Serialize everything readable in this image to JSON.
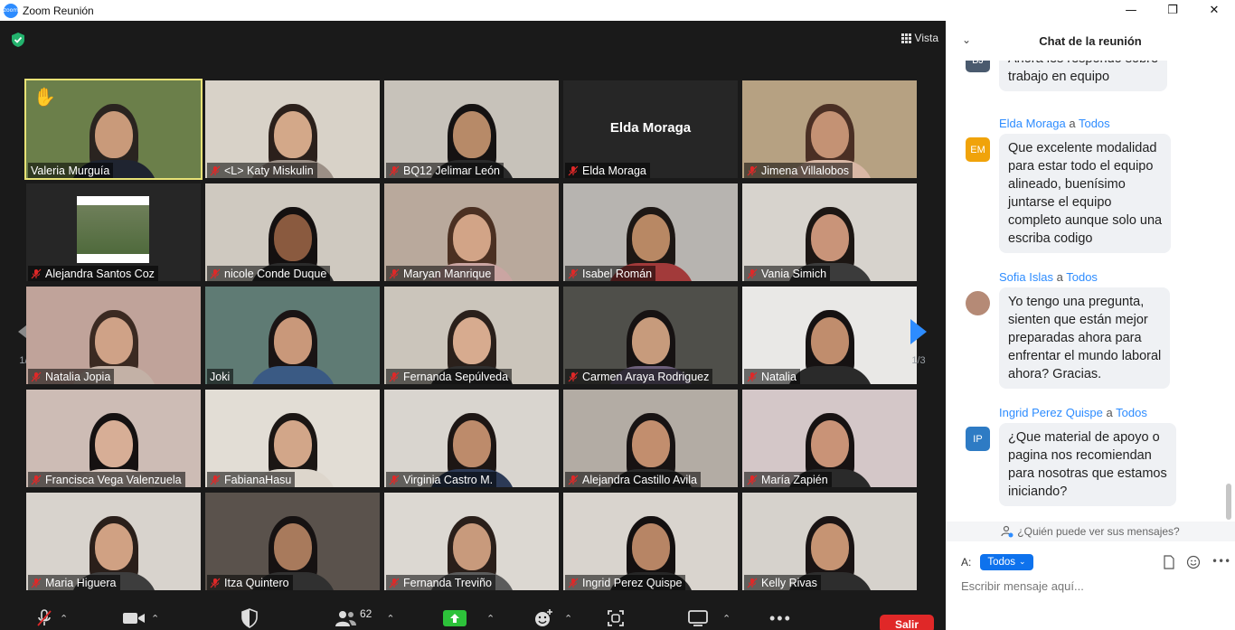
{
  "window": {
    "title": "Zoom Reunión",
    "controls": [
      "—",
      "❐",
      "✕"
    ]
  },
  "view_button": {
    "label": "Vista"
  },
  "pages": {
    "left_indicator": "1/3",
    "right_indicator": "1/3"
  },
  "participants": [
    {
      "name": "Valeria Murguía",
      "muted": false,
      "active": true,
      "hand_raised": true,
      "bg": "#6b7f4a",
      "skin": "#c99a7a",
      "hair": "#2a2420",
      "shirt": "#1f2430"
    },
    {
      "name": "<L> Katy Miskulin",
      "muted": true,
      "bg": "#d8d2c8",
      "skin": "#d3a889",
      "hair": "#2b201b",
      "shirt": "#9b8f86"
    },
    {
      "name": "BQ12 Jelimar León",
      "muted": true,
      "bg": "#c7c2ba",
      "skin": "#b78a68",
      "hair": "#151212",
      "shirt": "#2a2a2a"
    },
    {
      "name": "Elda Moraga",
      "muted": true,
      "video_off": true,
      "display_name": "Elda Moraga"
    },
    {
      "name": "Jimena Villalobos",
      "muted": true,
      "bg": "#b6a182",
      "skin": "#c49274",
      "hair": "#4a2f24",
      "shirt": "#d9b7a5"
    },
    {
      "name": "Alejandra Santos Coz",
      "muted": true,
      "photo_thumb": true
    },
    {
      "name": "nicole Conde Duque",
      "muted": true,
      "bg": "#cfc9c0",
      "skin": "#8a5a3f",
      "hair": "#141010",
      "shirt": "#2b2b2b"
    },
    {
      "name": "Maryan Manrique",
      "muted": true,
      "bg": "#b9a99c",
      "skin": "#d2a487",
      "hair": "#4b3022",
      "shirt": "#caa5a2"
    },
    {
      "name": "Isabel Román",
      "muted": true,
      "bg": "#b7b4b0",
      "skin": "#b88864",
      "hair": "#1d1714",
      "shirt": "#a23a3a"
    },
    {
      "name": "Vania Simich",
      "muted": true,
      "bg": "#d7d3cd",
      "skin": "#c99479",
      "hair": "#1c1613",
      "shirt": "#3b3b3b"
    },
    {
      "name": "Natalia Jopia",
      "muted": true,
      "bg": "#c0a39a",
      "skin": "#cfa287",
      "hair": "#3b2a22",
      "shirt": "#c3b1a6"
    },
    {
      "name": "Joki",
      "muted": false,
      "bg": "#5f7b74",
      "skin": "#c9987a",
      "hair": "#1a1414",
      "shirt": "#3a5a84"
    },
    {
      "name": "Fernanda Sepúlveda",
      "muted": true,
      "bg": "#cbc5bb",
      "skin": "#d7ab8f",
      "hair": "#2a201b",
      "shirt": "#2f2f2f"
    },
    {
      "name": "Carmen Araya Rodriguez",
      "muted": true,
      "bg": "#4f4f4a",
      "skin": "#c79b7c",
      "hair": "#161212",
      "shirt": "#6c5f7a"
    },
    {
      "name": "Natalia",
      "muted": true,
      "bg": "#e9e8e6",
      "skin": "#c08d6d",
      "hair": "#161212",
      "shirt": "#2a2a2a"
    },
    {
      "name": "Francisca Vega Valenzuela",
      "muted": true,
      "bg": "#cdbcb5",
      "skin": "#d7ae96",
      "hair": "#151111",
      "shirt": "#d9c9c0"
    },
    {
      "name": "FabianaHasu",
      "muted": true,
      "bg": "#e2ddd5",
      "skin": "#d2a689",
      "hair": "#1b1614",
      "shirt": "#ddd6cc"
    },
    {
      "name": "Virginia Castro M.",
      "muted": true,
      "bg": "#d9d5cf",
      "skin": "#bd8b6b",
      "hair": "#1d1614",
      "shirt": "#2c3a56"
    },
    {
      "name": "Alejandra Castillo Avila",
      "muted": true,
      "bg": "#b3aca4",
      "skin": "#c28e6e",
      "hair": "#181313",
      "shirt": "#2b2b2b"
    },
    {
      "name": "María Zapién",
      "muted": true,
      "bg": "#d4c7c8",
      "skin": "#c99377",
      "hair": "#171212",
      "shirt": "#2a2a2a"
    },
    {
      "name": "Maria Higuera",
      "muted": true,
      "bg": "#d8d3cd",
      "skin": "#d0a183",
      "hair": "#2a1f1a",
      "shirt": "#3d3d3d"
    },
    {
      "name": "Itza Quintero",
      "muted": true,
      "bg": "#5a524c",
      "skin": "#a87a5c",
      "hair": "#161212",
      "shirt": "#303030"
    },
    {
      "name": "Fernanda Treviño",
      "muted": true,
      "bg": "#dcd8d2",
      "skin": "#c89a7c",
      "hair": "#2a1f1a",
      "shirt": "#5b5b5b"
    },
    {
      "name": "Ingrid Perez Quispe",
      "muted": true,
      "bg": "#d9d4ce",
      "skin": "#b78565",
      "hair": "#141010",
      "shirt": "#262626"
    },
    {
      "name": "Kelly Rivas",
      "muted": true,
      "bg": "#d6d2cc",
      "skin": "#c69473",
      "hair": "#1a1414",
      "shirt": "#2d2d2d"
    }
  ],
  "toolbar": {
    "participants_count": "62",
    "leave_label": "Salir"
  },
  "chat": {
    "title": "Chat de la reunión",
    "messages": [
      {
        "partial": true,
        "avatar": "BJ",
        "avatar_color": "#4a5a6e",
        "lines": [
          "Ahora les respondo sobre",
          "trabajo en equipo"
        ]
      },
      {
        "sender": "Elda Moraga",
        "to_word": "a",
        "to": "Todos",
        "avatar": "EM",
        "avatar_color": "#f0a30a",
        "lines": [
          "Que excelente modalidad",
          "para estar todo el equipo",
          "alineado, buenísimo",
          "juntarse el equipo",
          "completo aunque solo una",
          "escriba codigo"
        ]
      },
      {
        "sender": "Sofia Islas",
        "to_word": "a",
        "to": "Todos",
        "avatar": "",
        "avatar_color": "#b58a76",
        "lines": [
          "Yo tengo una pregunta,",
          "sienten que están mejor",
          "preparadas ahora para",
          "enfrentar el mundo laboral",
          "ahora? Gracias."
        ]
      },
      {
        "sender": "Ingrid Perez Quispe",
        "to_word": "a",
        "to": "Todos",
        "avatar": "IP",
        "avatar_color": "#2e7bc4",
        "lines": [
          "¿Que material de apoyo o",
          "pagina nos recomiendan",
          "para nosotras que estamos",
          "iniciando?"
        ]
      }
    ],
    "who_can_see": "¿Quién puede ver sus mensajes?",
    "to_label": "A:",
    "recipient": "Todos",
    "input_placeholder": "Escribir mensaje aquí..."
  }
}
